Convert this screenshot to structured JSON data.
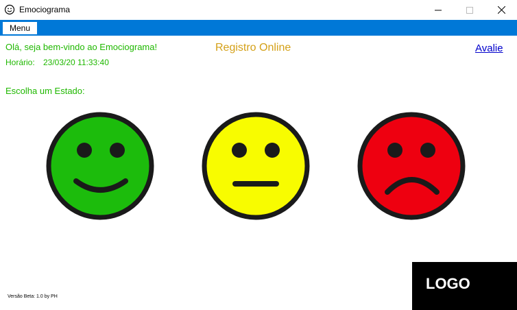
{
  "window": {
    "title": "Emociograma",
    "icon": "smiley-icon",
    "controls": [
      "minimize-icon",
      "maximize-icon",
      "close-icon"
    ]
  },
  "menu": {
    "label": "Menu",
    "bar_color": "#0078d7"
  },
  "header": {
    "greeting": "Olá, seja bem-vindo ao Emociograma!",
    "time_label": "Horário:",
    "time_value": "23/03/20 11:33:40",
    "registro": "Registro Online",
    "avalie": "Avalie"
  },
  "choose_label": "Escolha um Estado:",
  "faces": [
    {
      "name": "happy",
      "color": "#1cbc0c"
    },
    {
      "name": "neutral",
      "color": "#f8fc00"
    },
    {
      "name": "sad",
      "color": "#ee0010"
    }
  ],
  "footer": {
    "version": "Versão Beta: 1.0 by PH",
    "logo": "LOGO"
  },
  "colors": {
    "text_green": "#1fb800",
    "registro_gold": "#d4a017",
    "link_blue": "#0000cc"
  }
}
